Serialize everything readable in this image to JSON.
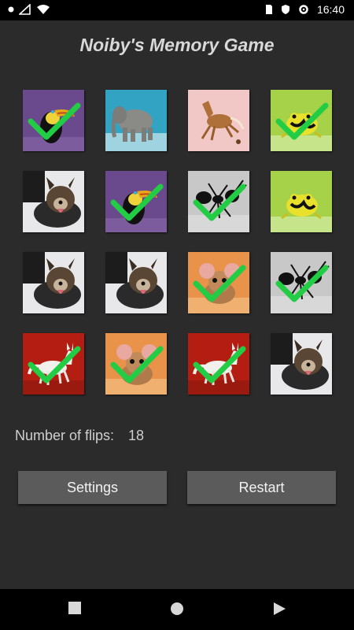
{
  "status_bar": {
    "time": "16:40"
  },
  "game": {
    "title": "Noiby's Memory Game",
    "flips_label": "Number of flips:",
    "flips_count": "18"
  },
  "cards": [
    {
      "animal": "toucan",
      "matched": true
    },
    {
      "animal": "elephant",
      "matched": false
    },
    {
      "animal": "horse",
      "matched": false
    },
    {
      "animal": "frog",
      "matched": true
    },
    {
      "animal": "dog",
      "matched": false
    },
    {
      "animal": "toucan",
      "matched": true
    },
    {
      "animal": "ant",
      "matched": true
    },
    {
      "animal": "frog",
      "matched": false
    },
    {
      "animal": "dog",
      "matched": false
    },
    {
      "animal": "dog",
      "matched": false
    },
    {
      "animal": "mouse",
      "matched": true
    },
    {
      "animal": "ant",
      "matched": true
    },
    {
      "animal": "wolf",
      "matched": true
    },
    {
      "animal": "mouse",
      "matched": true
    },
    {
      "animal": "wolf",
      "matched": true
    },
    {
      "animal": "dog",
      "matched": false
    }
  ],
  "buttons": {
    "settings": "Settings",
    "restart": "Restart"
  },
  "colors": {
    "background": "#2b2b2b",
    "button": "#5b5b5b",
    "check": "#22cc44"
  }
}
